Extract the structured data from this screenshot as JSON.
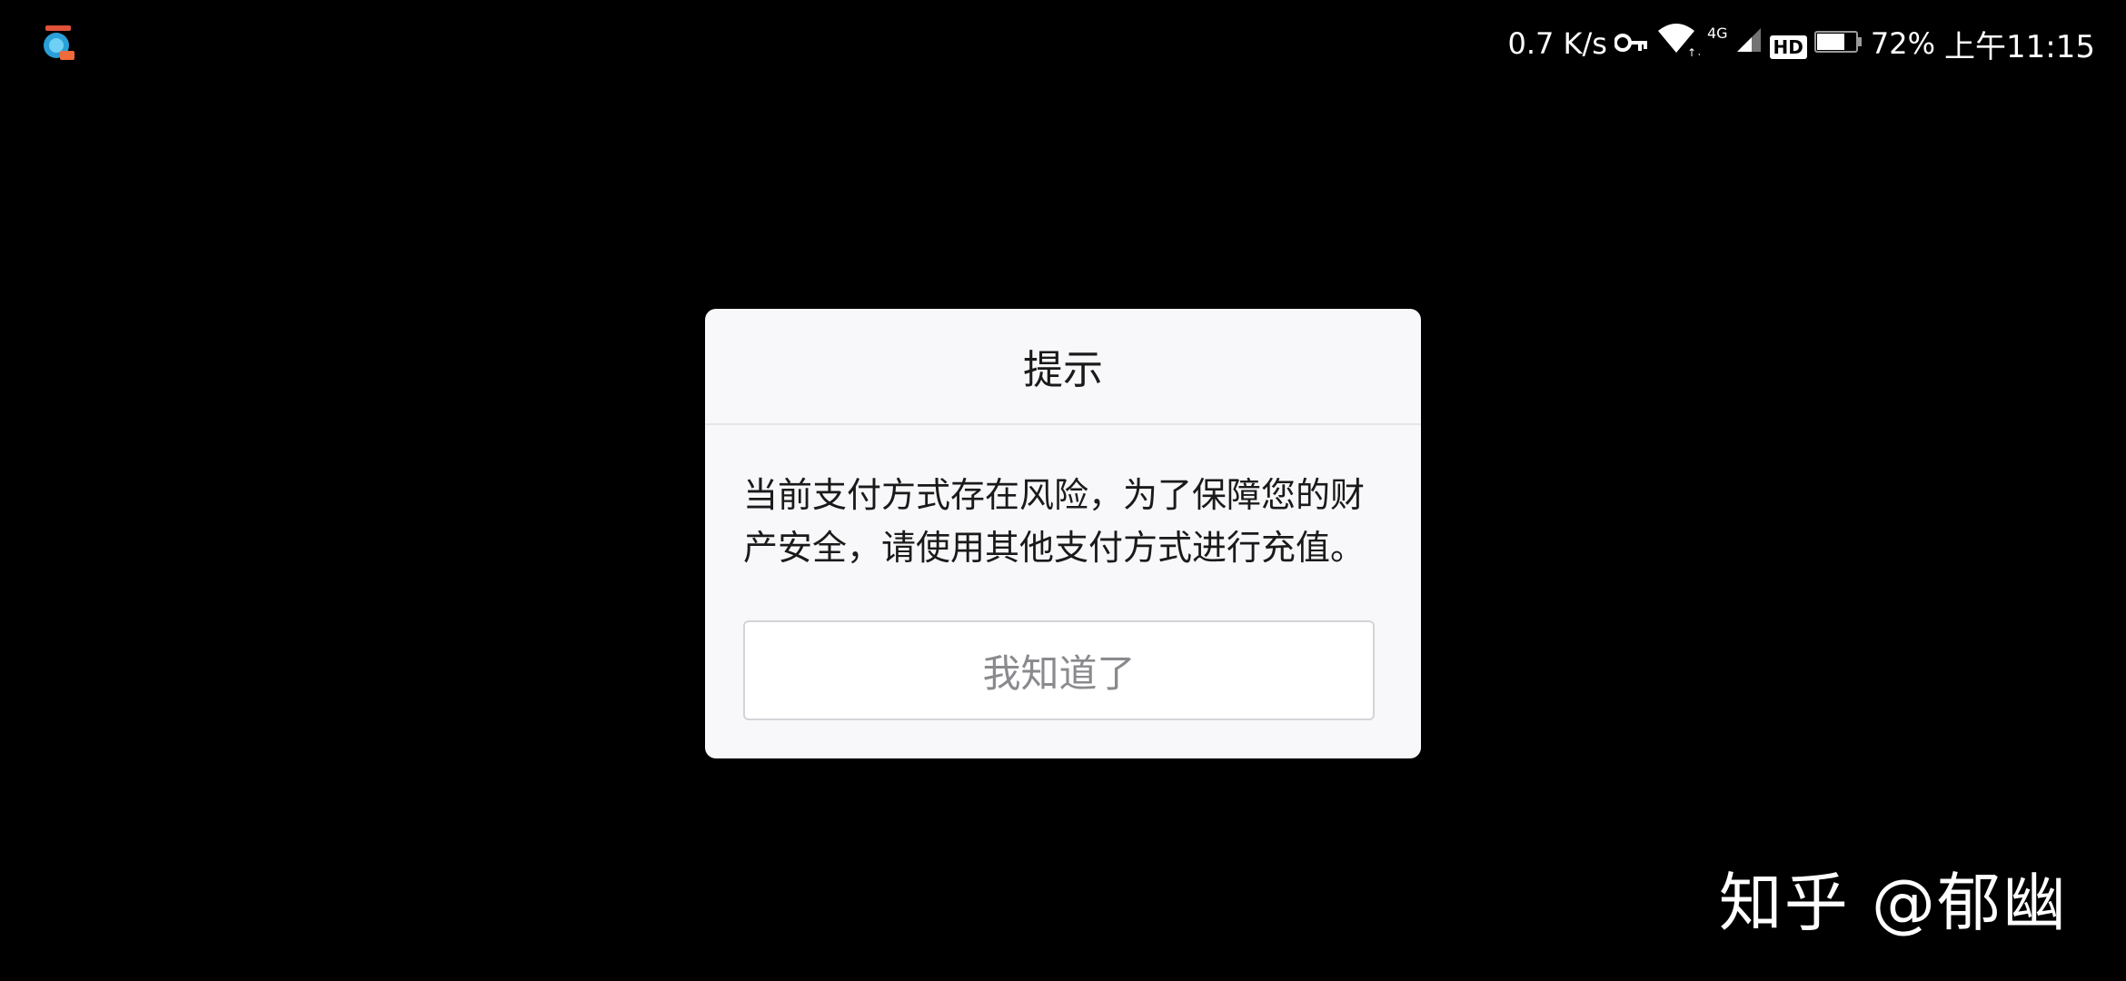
{
  "status_bar": {
    "net_speed": "0.7 K/s",
    "network_type": "4G",
    "hd_badge": "HD",
    "battery_percent": "72%",
    "battery_level": 0.72,
    "time": "上午11:15",
    "icons": [
      "app-notification-icon",
      "vpn-key-icon",
      "wifi-icon",
      "cellular-signal-icon",
      "hd-call-icon",
      "battery-icon"
    ]
  },
  "dialog": {
    "title": "提示",
    "message": "当前支付方式存在风险，为了保障您的财产安全，请使用其他支付方式进行充值。",
    "button_label": "我知道了"
  },
  "watermark": {
    "text": "知乎 @郁幽"
  },
  "colors": {
    "background": "#000000",
    "dialog_bg": "#f8f8fa",
    "button_text": "#8a8a8e",
    "title_text": "#1a1a1a"
  }
}
